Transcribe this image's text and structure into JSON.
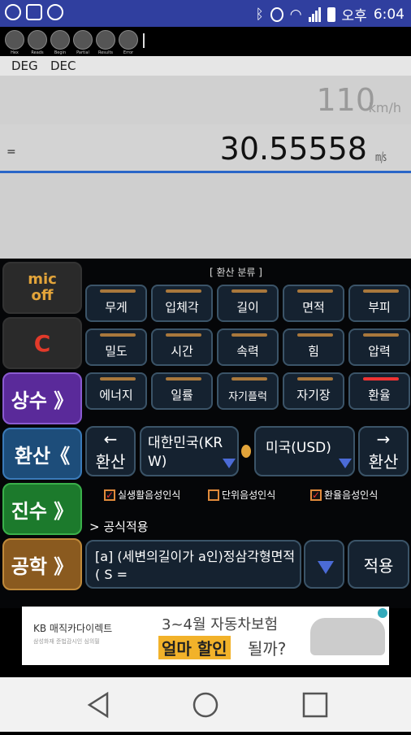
{
  "status_bar": {
    "ampm": "오후",
    "time": "6:04",
    "icons": [
      "sync-icon",
      "image-icon",
      "refresh-icon",
      "bluetooth-icon",
      "alarm-icon",
      "wifi-icon",
      "signal-icon",
      "battery-icon"
    ]
  },
  "indicators": {
    "labels": [
      "Hex",
      "Reads",
      "Begin",
      "Partial",
      "Results",
      "Error"
    ]
  },
  "modes": {
    "angle": "DEG",
    "base": "DEC"
  },
  "display": {
    "input_value": "110",
    "input_unit": "km/h",
    "equals": "=",
    "result_value": "30.55558",
    "result_unit": "㎧"
  },
  "left_buttons": {
    "mic": "mic\noff",
    "clear": "C",
    "constants": "상수 》",
    "convert": "환산《",
    "base": "진수 》",
    "engineering": "공학 》"
  },
  "categories": {
    "title": "[ 환산 분류 ]",
    "rows": [
      [
        "무게",
        "입체각",
        "길이",
        "면적",
        "부피"
      ],
      [
        "밀도",
        "시간",
        "속력",
        "힘",
        "압력"
      ],
      [
        "에너지",
        "일률",
        "자기플럭",
        "자기장",
        "환율"
      ]
    ]
  },
  "conversion": {
    "prev_arrow": "←",
    "prev_label": "환산",
    "from_currency": "대한민국(KRW)",
    "to_currency": "미국(USD)",
    "next_arrow": "→",
    "next_label": "환산"
  },
  "checkboxes": [
    {
      "label": "실생활음성인식",
      "checked": true
    },
    {
      "label": "단위음성인식",
      "checked": false
    },
    {
      "label": "환율음성인식",
      "checked": true
    }
  ],
  "formula": {
    "section_label": "> 공식적용",
    "text": "[a] (세변의길이가 a인)정삼각형면적( S =",
    "apply_label": "적용"
  },
  "ad": {
    "brand": "KB 매직카다이렉트",
    "fine_print": "삼성화재 준법감시인 심의필",
    "headline": "3~4월 자동차보험",
    "highlight": "얼마 할인",
    "tail": "될까?"
  },
  "colors": {
    "status_bar": "#303f9f",
    "accent_line": "#2a66c8",
    "mic_text": "#e3a43a",
    "clear_text": "#e23a2a",
    "constants_bg": "#5a2a9a",
    "convert_bg": "#1d4d7a",
    "base_bg": "#1c7a2c",
    "engineering_bg": "#8a5a1f"
  }
}
